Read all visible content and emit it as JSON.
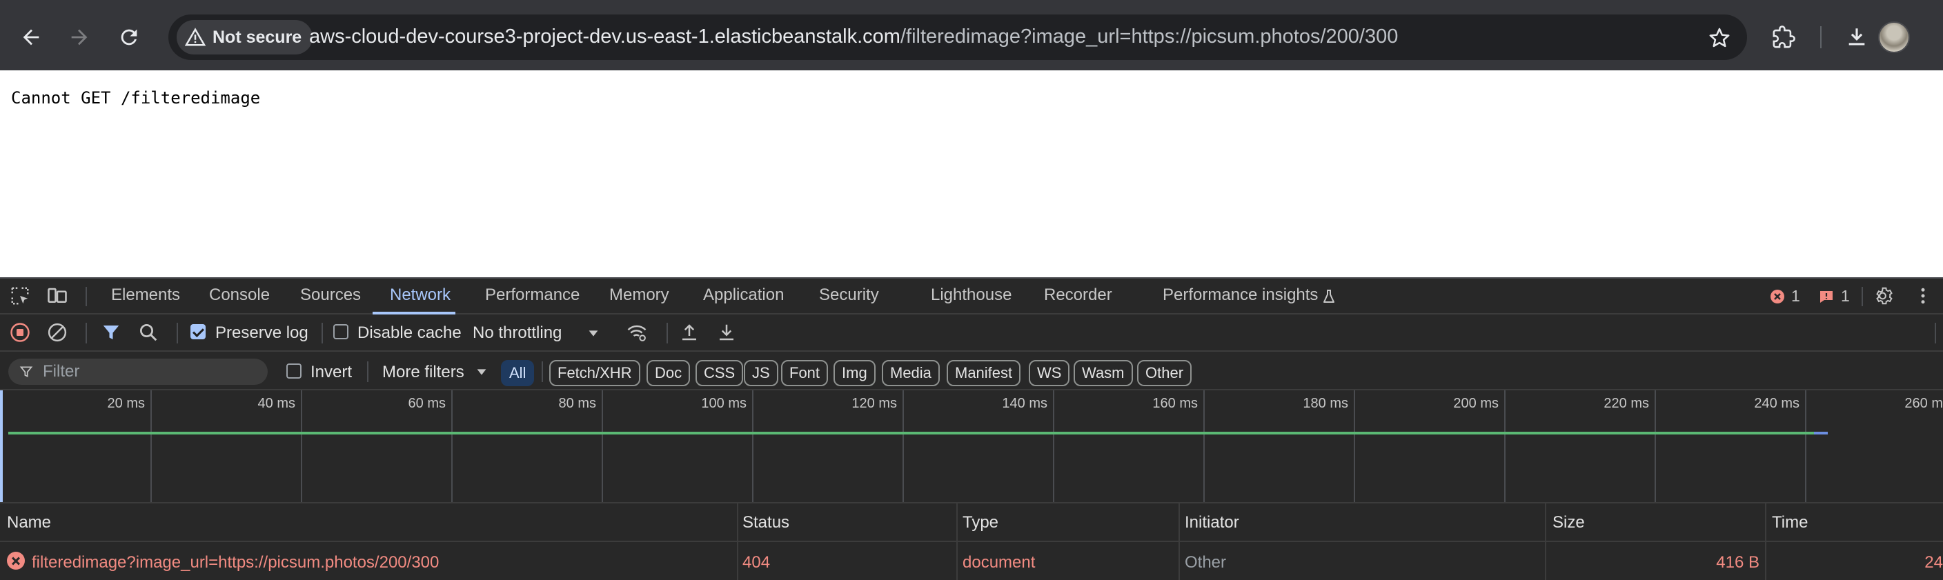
{
  "browser": {
    "security_label": "Not secure",
    "url_host": "aws-cloud-dev-course3-project-dev.us-east-1.elasticbeanstalk.com",
    "url_path": "/filteredimage?image_url=https://picsum.photos/200/300"
  },
  "page": {
    "message": "Cannot GET /filteredimage"
  },
  "devtools": {
    "tabs": [
      "Elements",
      "Console",
      "Sources",
      "Network",
      "Performance",
      "Memory",
      "Application",
      "Security",
      "Lighthouse",
      "Recorder",
      "Performance insights"
    ],
    "active_tab": "Network",
    "error_count": "1",
    "issue_count": "1",
    "controls": {
      "preserve_log_label": "Preserve log",
      "preserve_log_checked": true,
      "disable_cache_label": "Disable cache",
      "disable_cache_checked": false,
      "throttling": "No throttling"
    },
    "filter": {
      "placeholder": "Filter",
      "invert_label": "Invert",
      "more_filters_label": "More filters",
      "types": [
        "All",
        "Fetch/XHR",
        "Doc",
        "CSS",
        "JS",
        "Font",
        "Img",
        "Media",
        "Manifest",
        "WS",
        "Wasm",
        "Other"
      ],
      "active_type": "All"
    },
    "overview": {
      "tick_labels": [
        "20 ms",
        "40 ms",
        "60 ms",
        "80 ms",
        "100 ms",
        "120 ms",
        "140 ms",
        "160 ms",
        "180 ms",
        "200 ms",
        "220 ms",
        "240 ms",
        "260 ms"
      ],
      "request_end_ms": 243
    },
    "columns": [
      "Name",
      "Status",
      "Type",
      "Initiator",
      "Size",
      "Time"
    ],
    "requests": [
      {
        "name": "filteredimage?image_url=https://picsum.photos/200/300",
        "status": "404",
        "type": "document",
        "initiator": "Other",
        "size": "416 B",
        "time": "24"
      }
    ]
  }
}
